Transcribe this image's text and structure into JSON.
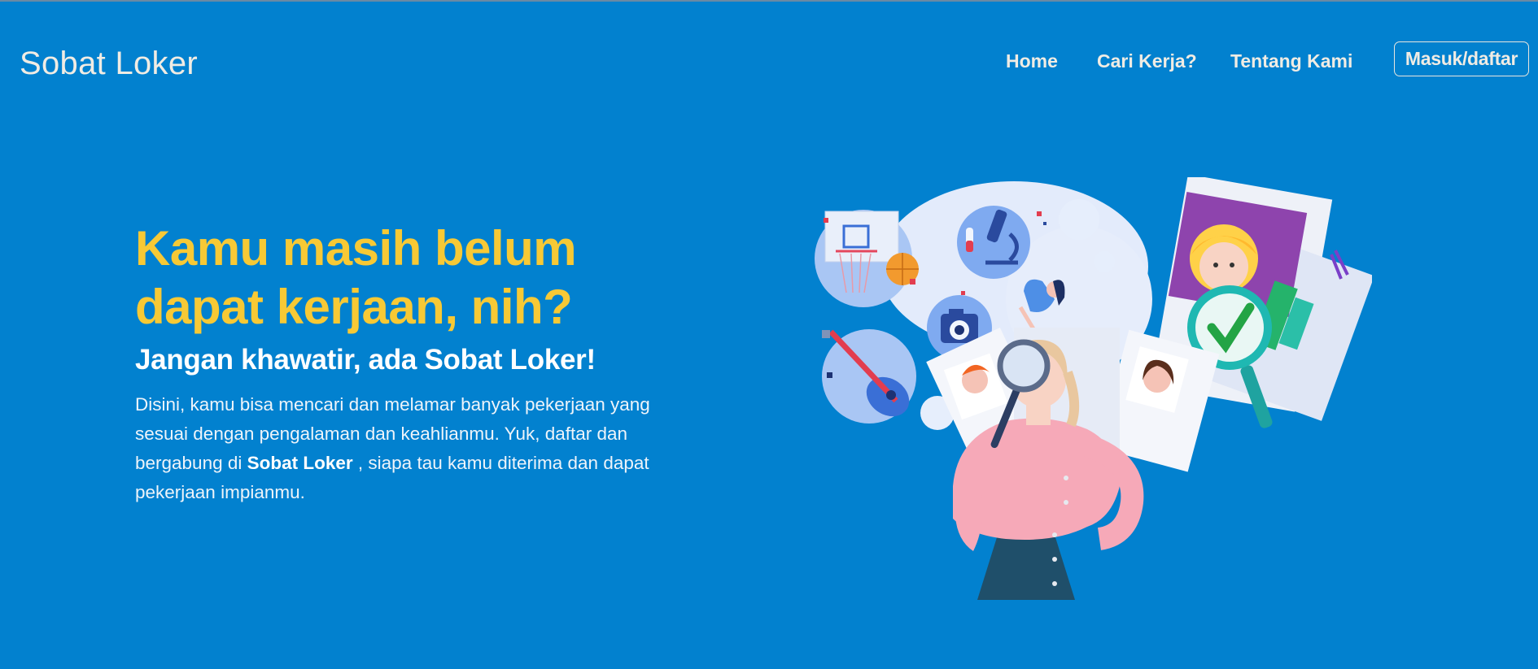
{
  "navbar": {
    "brand": "Sobat Loker",
    "links": [
      {
        "label": "Home"
      },
      {
        "label": "Cari Kerja?"
      },
      {
        "label": "Tentang Kami"
      }
    ],
    "cta_label": "Masuk/daftar"
  },
  "hero": {
    "title": "Kamu masih belum dapat kerjaan, nih?",
    "subtitle": "Jangan khawatir, ada Sobat Loker!",
    "description_before": "Disini, kamu bisa mencari dan melamar banyak pekerjaan yang sesuai dengan pengalaman dan keahlianmu. Yuk, daftar dan bergabung di ",
    "description_bold": "Sobat Loker",
    "description_after": " , siapa tau kamu diterima dan dapat pekerjaan impianmu."
  },
  "colors": {
    "background": "#0281cf",
    "title": "#f7c935",
    "nav_text": "#f0ece4"
  },
  "illustration_icons": [
    "basketball-icon",
    "microscope-icon",
    "camera-icon",
    "guitar-icon",
    "magnifier-icon",
    "check-icon"
  ]
}
